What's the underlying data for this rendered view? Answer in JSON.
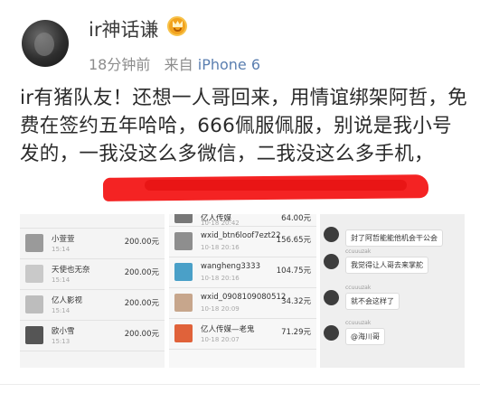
{
  "post": {
    "username": "ir神话谦",
    "time": "18分钟前",
    "source_prefix": "来自",
    "source": "iPhone 6",
    "text": "ir有猪队友！还想一人哥回来，用情谊绑架阿哲，免费在签约五年哈哈，666佩服佩服，别说是我小号发的，一我没这么多微信，二我没这么多手机，"
  },
  "screenshot_a": {
    "rows": [
      {
        "name": "",
        "time": "",
        "amount": ""
      },
      {
        "name": "小萱萱",
        "time": "15:14",
        "amount": "200.00元"
      },
      {
        "name": "天使也无奈",
        "time": "15:14",
        "amount": "200.00元"
      },
      {
        "name": "亿人影视",
        "time": "15:14",
        "amount": "200.00元"
      },
      {
        "name": "欧小雪",
        "time": "15:13",
        "amount": "200.00元"
      }
    ]
  },
  "screenshot_b": {
    "rows": [
      {
        "name": "亿人传媒",
        "time": "10-18 20:42",
        "amount": "64.00元"
      },
      {
        "name": "wxid_btn6loof7ezt22",
        "time": "10-18 20:16",
        "amount": "156.65元"
      },
      {
        "name": "wangheng3333",
        "time": "10-18 20:16",
        "amount": "104.75元"
      },
      {
        "name": "wxid_0908109080512",
        "time": "10-18 20:09",
        "amount": "34.32元"
      },
      {
        "name": "亿人传媒—老鬼",
        "time": "10-18 20:07",
        "amount": "71.29元"
      }
    ]
  },
  "screenshot_c": {
    "messages": [
      {
        "sender": "",
        "text": "封了阿哲能能他机会干公会"
      },
      {
        "sender": "ccuuuzak",
        "text": "我觉得让人哥去来掌舵"
      },
      {
        "sender": "ccuuuzak",
        "text": "就不会这样了"
      },
      {
        "sender": "ccuuuzak",
        "text": "@海川哥"
      }
    ]
  }
}
